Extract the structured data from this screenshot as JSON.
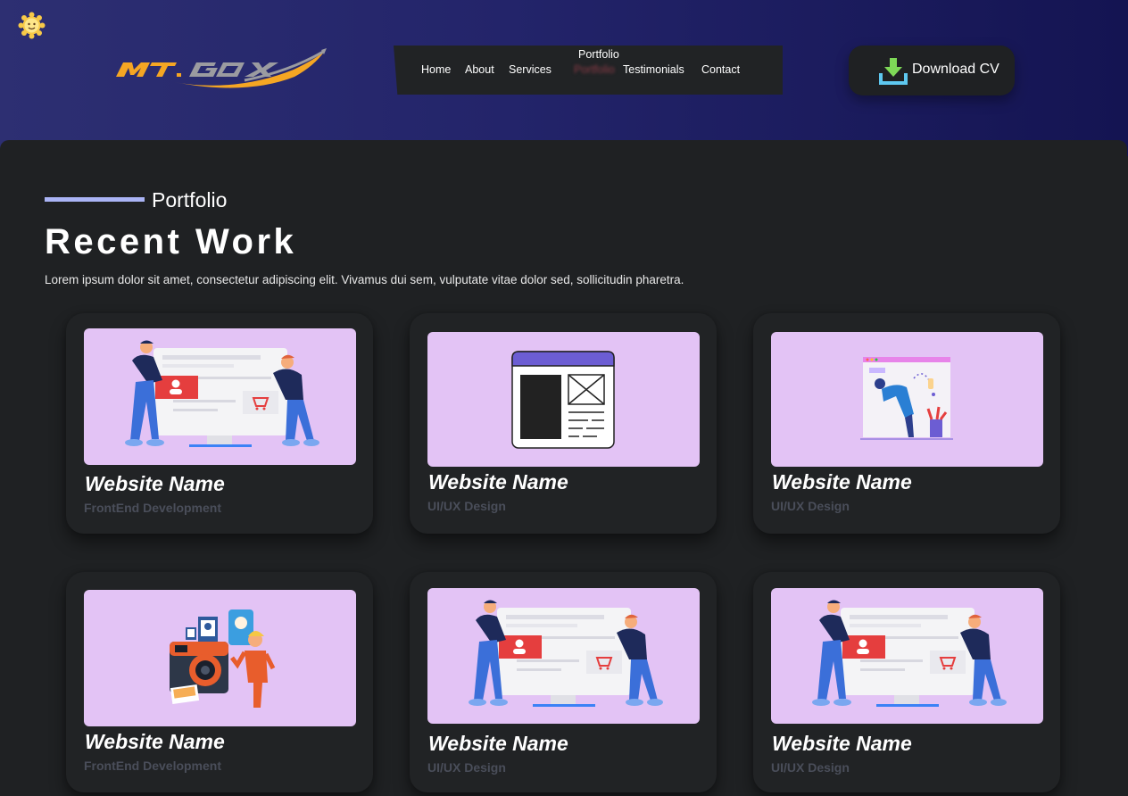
{
  "header": {
    "logo_text": "MT.GOX",
    "nav": {
      "items": [
        {
          "label": "Home"
        },
        {
          "label": "About"
        },
        {
          "label": "Services"
        },
        {
          "label": "Testimonials"
        },
        {
          "label": "Contact"
        }
      ],
      "hover_tooltip": "Portfolio",
      "hover_item": "Portfolio"
    },
    "cv_button": {
      "label": "Download CV",
      "icon": "download-icon"
    }
  },
  "section": {
    "eyebrow": "Portfolio",
    "title": "Recent Work",
    "description": "Lorem ipsum dolor sit amet, consectetur adipiscing elit. Vivamus dui sem, vulputate vitae dolor sed, sollicitudin pharetra."
  },
  "projects": [
    {
      "title": "Website Name",
      "category": "FrontEnd Development",
      "illustration": "ecommerce-illustration"
    },
    {
      "title": "Website Name",
      "category": "UI/UX Design",
      "illustration": "wireframe-illustration"
    },
    {
      "title": "Website Name",
      "category": "UI/UX Design",
      "illustration": "designer-illustration"
    },
    {
      "title": "Website Name",
      "category": "FrontEnd Development",
      "illustration": "camera-illustration"
    },
    {
      "title": "Website Name",
      "category": "UI/UX Design",
      "illustration": "ecommerce-illustration"
    },
    {
      "title": "Website Name",
      "category": "UI/UX Design",
      "illustration": "ecommerce-illustration"
    }
  ],
  "colors": {
    "accent_line": "#aab4f5",
    "card_image_bg": "#e3c3f5",
    "logo_orange": "#f5a623",
    "logo_gray": "#8e8e93",
    "page_bg": "#1f2123",
    "hero_gradient_start": "#2d2f72",
    "hero_gradient_end": "#141452"
  }
}
